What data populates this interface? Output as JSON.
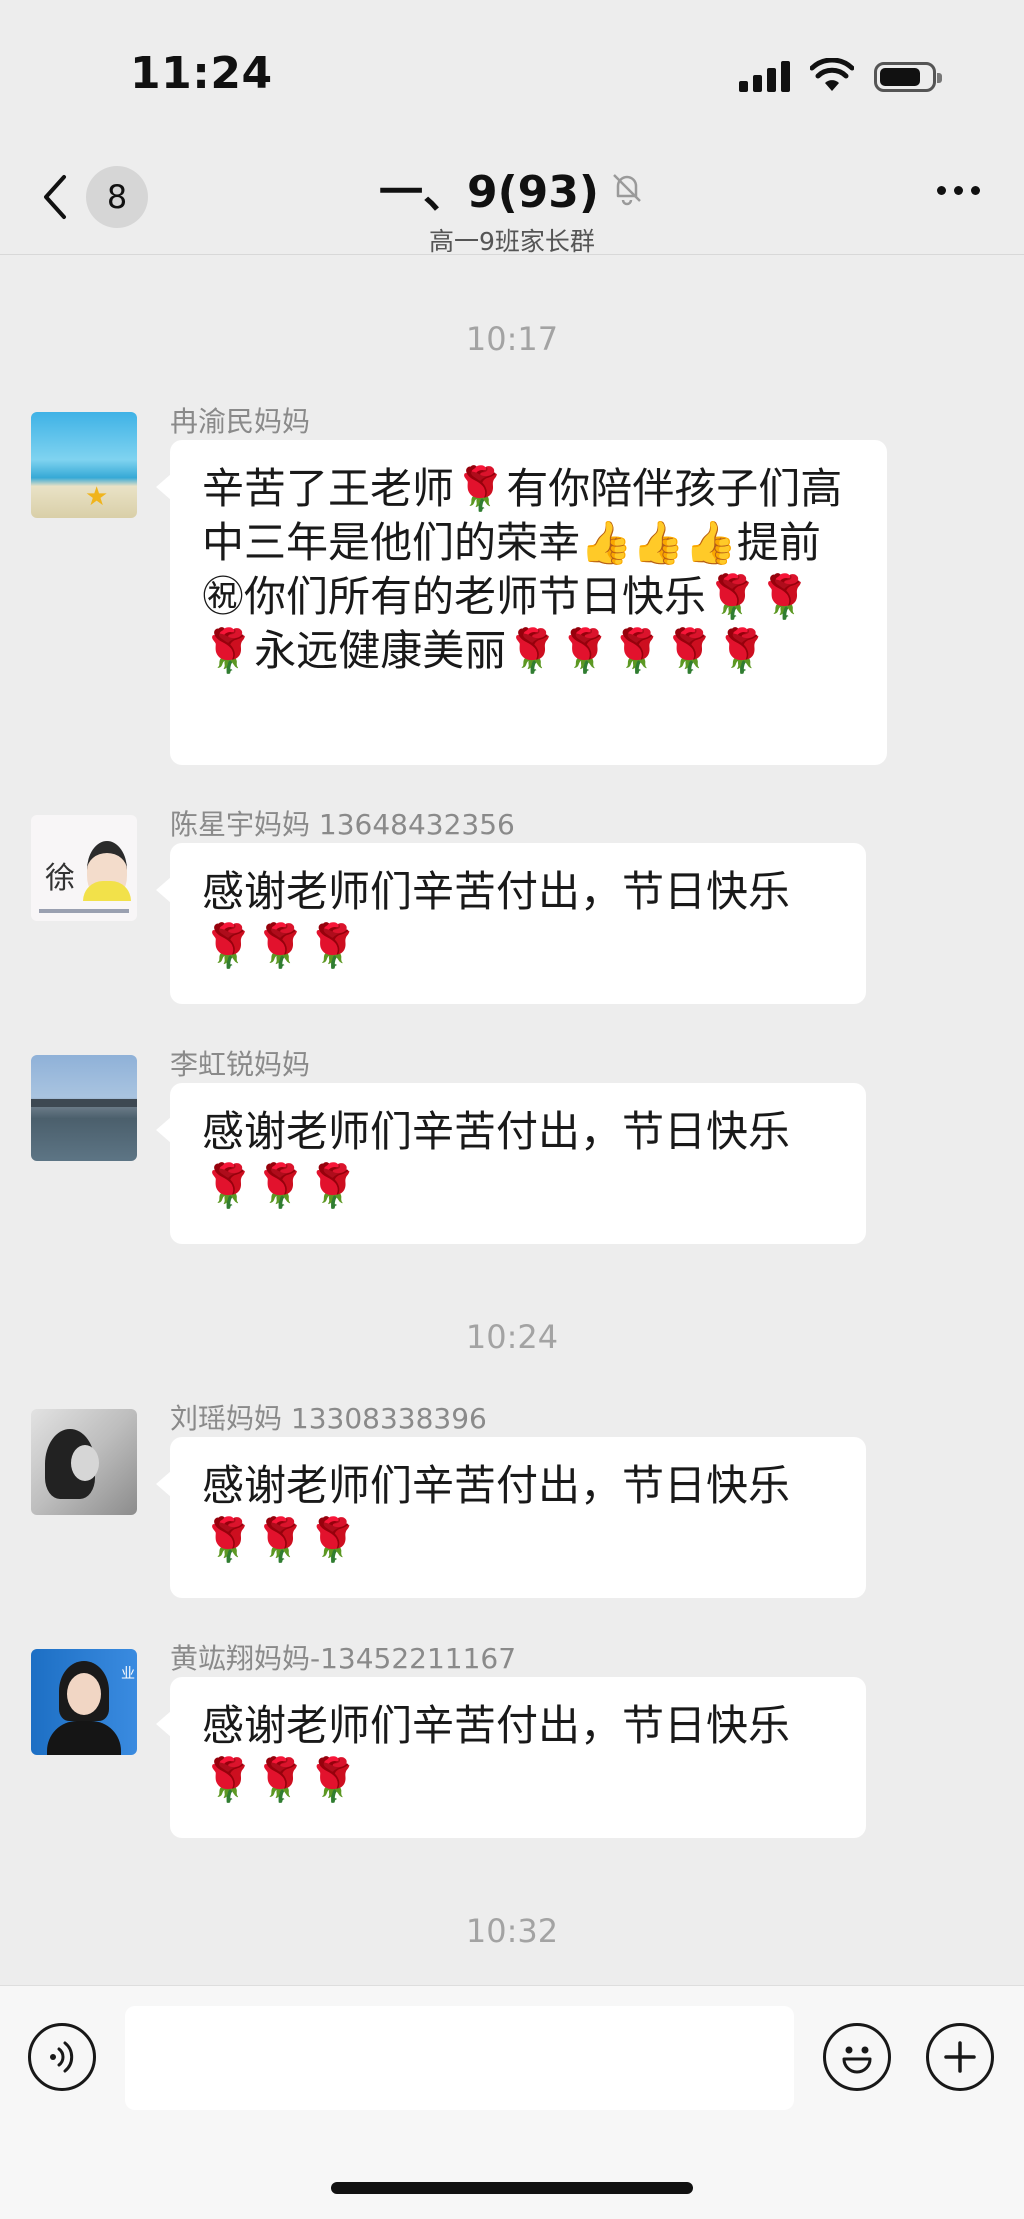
{
  "status_bar": {
    "time": "11:24",
    "icons": [
      "cellular-signal-icon",
      "wifi-icon",
      "battery-icon"
    ],
    "battery_level": 0.8
  },
  "nav": {
    "back_badge": "8",
    "title": "一、9(93)",
    "subtitle": "高一9班家长群",
    "icons": [
      "back-chevron-icon",
      "mute-bell-icon",
      "more-icon"
    ]
  },
  "chat": {
    "timestamps": [
      "10:17",
      "10:24",
      "10:32"
    ],
    "messages": [
      {
        "sender": "冉渝民妈妈",
        "text": "辛苦了王老师🌹有你陪伴孩子们高中三年是他们的荣幸👍👍👍提前㊗你们所有的老师节日快乐🌹🌹🌹永远健康美丽🌹🌹🌹🌹🌹"
      },
      {
        "sender": "陈星宇妈妈 13648432356",
        "text": "感谢老师们辛苦付出，节日快乐🌹🌹🌹"
      },
      {
        "sender": "李虹锐妈妈",
        "text": "感谢老师们辛苦付出，节日快乐🌹🌹🌹"
      },
      {
        "sender": "刘瑶妈妈 13308338396",
        "text": "感谢老师们辛苦付出，节日快乐🌹🌹🌹"
      },
      {
        "sender": "黄竑翔妈妈-13452211167",
        "text": "感谢老师们辛苦付出，节日快乐🌹🌹🌹"
      }
    ]
  },
  "input_bar": {
    "icons": [
      "voice-icon",
      "emoji-icon",
      "plus-icon"
    ],
    "value": "",
    "placeholder": ""
  },
  "colors": {
    "background": "#ededed",
    "bubble": "#ffffff",
    "timestamp": "#a3a3a3",
    "sender": "#8a8a8a"
  }
}
